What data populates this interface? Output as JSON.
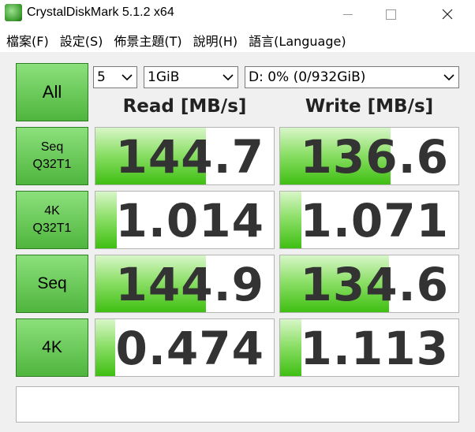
{
  "window": {
    "title": "CrystalDiskMark 5.1.2 x64"
  },
  "menu": [
    "檔案(F)",
    "設定(S)",
    "佈景主題(T)",
    "說明(H)",
    "語言(Language)"
  ],
  "controls": {
    "all_label": "All",
    "count": "5",
    "size": "1GiB",
    "drive": "D: 0% (0/932GiB)"
  },
  "columns": {
    "read": "Read [MB/s]",
    "write": "Write [MB/s]"
  },
  "tests": [
    {
      "label": "Seq\nQ32T1",
      "read": "144.7",
      "write": "136.6",
      "read_fill": 0.62,
      "write_fill": 0.62
    },
    {
      "label": "4K\nQ32T1",
      "read": "1.014",
      "write": "1.071",
      "read_fill": 0.12,
      "write_fill": 0.12
    },
    {
      "label": "Seq",
      "read": "144.9",
      "write": "134.6",
      "read_fill": 0.62,
      "write_fill": 0.61
    },
    {
      "label": "4K",
      "read": "0.474",
      "write": "1.113",
      "read_fill": 0.11,
      "write_fill": 0.12
    }
  ],
  "comment": ""
}
